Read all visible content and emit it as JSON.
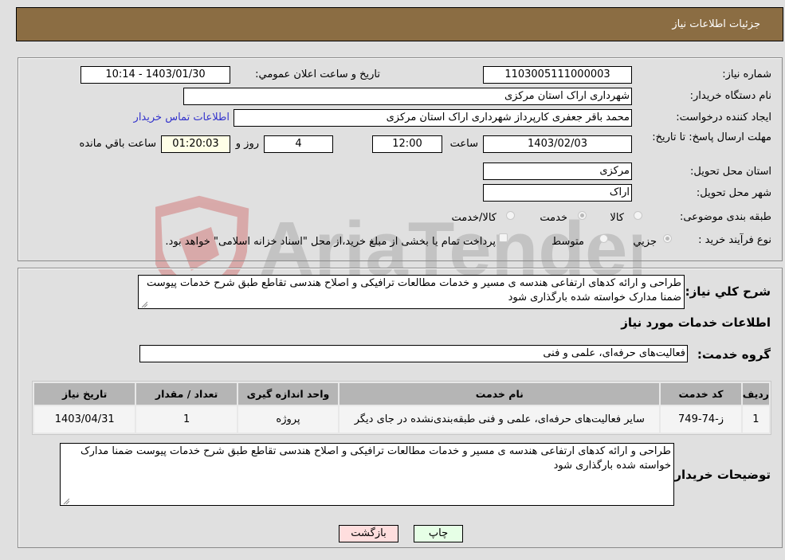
{
  "header": {
    "title": "جزئیات اطلاعات نیاز"
  },
  "details": {
    "need_number_label": "شماره نیاز:",
    "need_number": "1103005111000003",
    "announce_label": "تاریخ و ساعت اعلان عمومي:",
    "announce_value": "1403/01/30 - 10:14",
    "buyer_org_label": "نام دستگاه خریدار:",
    "buyer_org": "شهرداری اراک استان مرکزی",
    "creator_label": "ایجاد کننده درخواست:",
    "creator": "محمد باقر جعفری کارپرداز شهرداری اراک استان مرکزی",
    "contact_link": "اطلاعات تماس خریدار",
    "deadline_label": "مهلت ارسال پاسخ: تا تاریخ:",
    "deadline_date": "1403/02/03",
    "time_label": "ساعت",
    "deadline_time": "12:00",
    "days_value": "4",
    "days_label": "روز و",
    "remaining_time": "01:20:03",
    "remaining_label": "ساعت باقي مانده",
    "province_label": "استان محل تحویل:",
    "province": "مرکزی",
    "city_label": "شهر محل تحویل:",
    "city": "اراک",
    "category_label": "طبقه بندی موضوعی:",
    "category_options": [
      "کالا",
      "خدمت",
      "کالا/خدمت"
    ],
    "category_selected": "خدمت",
    "process_label": "نوع فرآیند خرید :",
    "process_options": [
      "جزيي",
      "متوسط"
    ],
    "treasury_note": "پرداخت تمام یا بخشی از مبلغ خرید،از محل \"اسناد خزانه اسلامی\" خواهد بود."
  },
  "description": {
    "label": "شرح کلي نیاز:",
    "text": "طراحی و ارائه کدهای ارتفاعی هندسه ی مسیر و خدمات مطالعات ترافیکی و اصلاح هندسی تقاطع طبق شرح خدمات پیوست ضمنا مدارک خواسته شده بارگذاری شود"
  },
  "services": {
    "section_title": "اطلاعات خدمات مورد نیاز",
    "group_label": "گروه خدمت:",
    "group_value": "فعالیت‌های حرفه‌ای، علمی و فنی",
    "columns": [
      "ردیف",
      "کد خدمت",
      "نام خدمت",
      "واحد اندازه گیری",
      "تعداد / مقدار",
      "تاریخ نیاز"
    ],
    "rows": [
      {
        "index": "1",
        "code": "ز-74-749",
        "name": "سایر فعالیت‌های حرفه‌ای، علمی و فنی طبقه‌بندی‌نشده در جای دیگر",
        "unit": "پروژه",
        "quantity": "1",
        "date": "1403/04/31"
      }
    ]
  },
  "buyer_notes": {
    "label": "توضیحات خریدار:",
    "text": "طراحی و ارائه کدهای ارتفاعی هندسه ی مسیر و خدمات مطالعات ترافیکی و اصلاح هندسی تقاطع طبق شرح خدمات پیوست ضمنا مدارک خواسته شده بارگذاری شود"
  },
  "buttons": {
    "print": "چاپ",
    "back": "بازگشت"
  },
  "watermark": {
    "text": "AriaTender.neT"
  }
}
